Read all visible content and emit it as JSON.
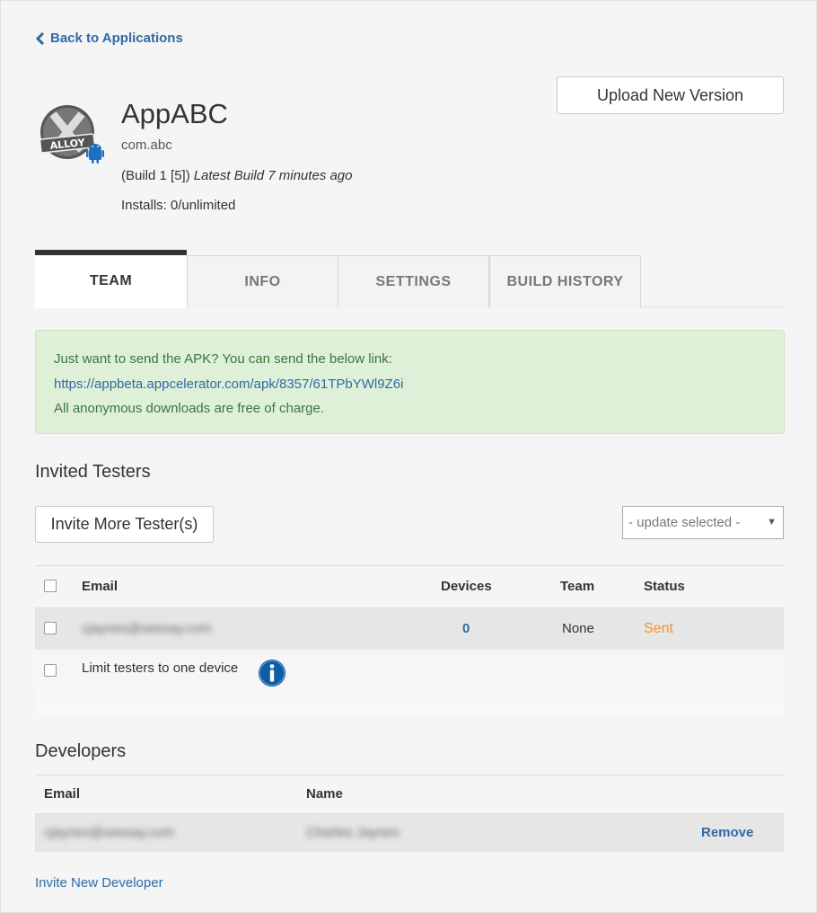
{
  "nav": {
    "back_label": "Back to Applications"
  },
  "app": {
    "name": "AppABC",
    "bundle_id": "com.abc",
    "build": "(Build 1 [5])",
    "latest_build": "Latest Build 7 minutes ago",
    "installs_label": "Installs:",
    "installs_value": "0/unlimited",
    "icon_text": "ALLOY"
  },
  "actions": {
    "upload_label": "Upload New Version"
  },
  "tabs": [
    {
      "label": "TEAM",
      "active": true
    },
    {
      "label": "INFO",
      "active": false
    },
    {
      "label": "SETTINGS",
      "active": false
    },
    {
      "label": "BUILD HISTORY",
      "active": false
    }
  ],
  "apk_notice": {
    "line1": "Just want to send the APK? You can send the below link:",
    "link": "https://appbeta.appcelerator.com/apk/8357/61TPbYWl9Z6i",
    "line3": "All anonymous downloads are free of charge."
  },
  "testers": {
    "heading": "Invited Testers",
    "invite_label": "Invite More Tester(s)",
    "bulk_select": {
      "selected": "- update selected -"
    },
    "columns": {
      "email": "Email",
      "devices": "Devices",
      "team": "Team",
      "status": "Status"
    },
    "rows": [
      {
        "email": "cjaynes@seesay.com",
        "devices": "0",
        "team": "None",
        "status": "Sent"
      }
    ],
    "limit_label": "Limit testers to one device"
  },
  "developers": {
    "heading": "Developers",
    "columns": {
      "email": "Email",
      "name": "Name"
    },
    "rows": [
      {
        "email": "cjaynes@seesay.com",
        "name": "Charles Jaynes",
        "action": "Remove"
      }
    ],
    "invite_label": "Invite New Developer"
  },
  "colors": {
    "link": "#2f6aa5",
    "status_sent": "#f0942a",
    "alert_bg": "#dff0d8",
    "alert_text": "#3c763d",
    "info_icon": "#0d5ca8"
  }
}
